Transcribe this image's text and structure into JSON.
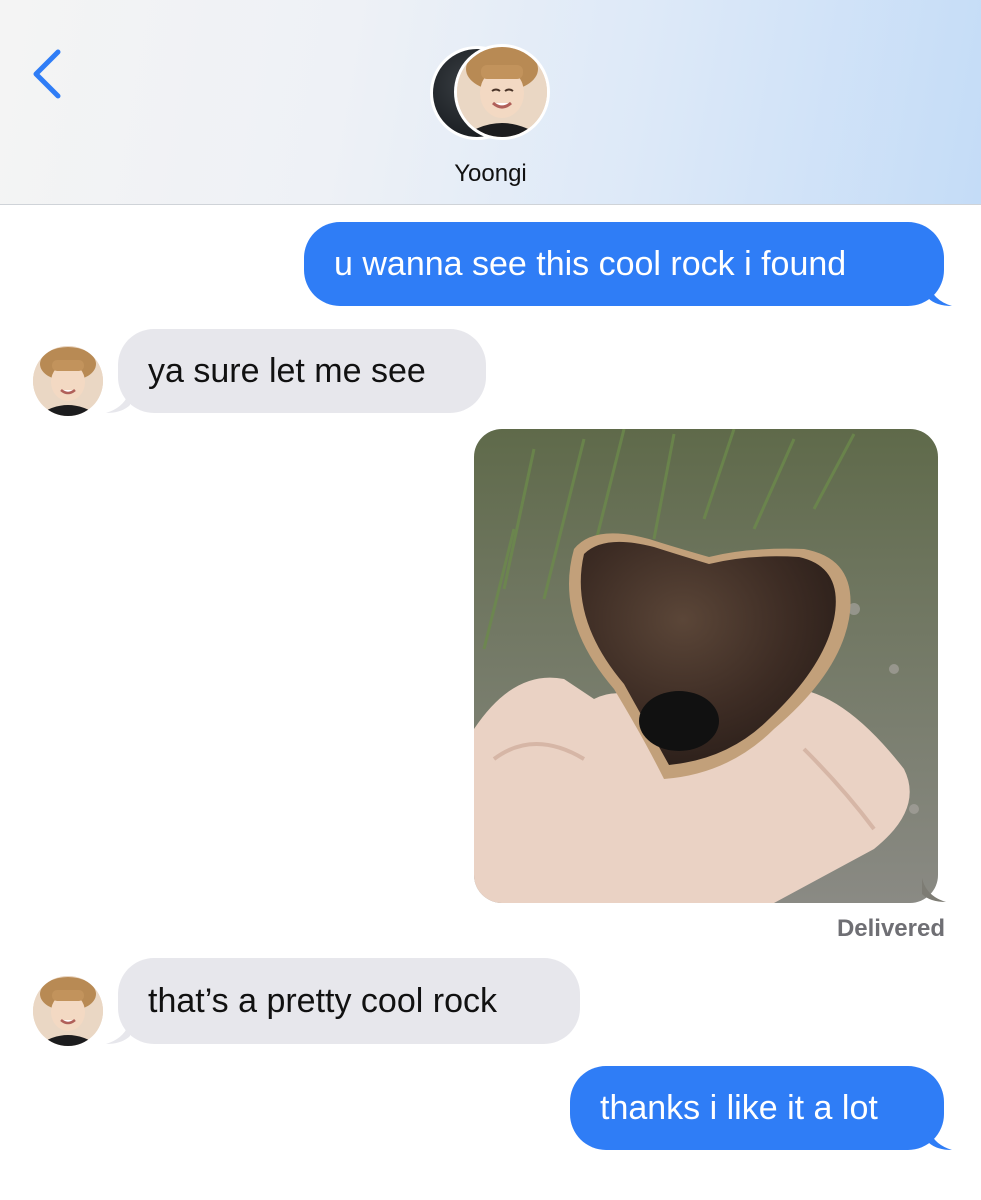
{
  "header": {
    "contact_name": "Yoongi",
    "back_icon": "chevron-left-icon"
  },
  "messages": [
    {
      "direction": "sent",
      "text": "u wanna see this cool rock i found"
    },
    {
      "direction": "received",
      "text": "ya sure let me see"
    },
    {
      "direction": "sent",
      "type": "photo",
      "image": "heart-shaped-rock-in-hand"
    },
    {
      "direction": "received",
      "text": "that’s a pretty cool rock"
    },
    {
      "direction": "sent",
      "text": "thanks i like it a lot"
    }
  ],
  "status": {
    "delivered": "Delivered"
  },
  "colors": {
    "sent_bubble": "#2f7df6",
    "received_bubble": "#e7e7ec",
    "accent": "#2f7df6"
  }
}
